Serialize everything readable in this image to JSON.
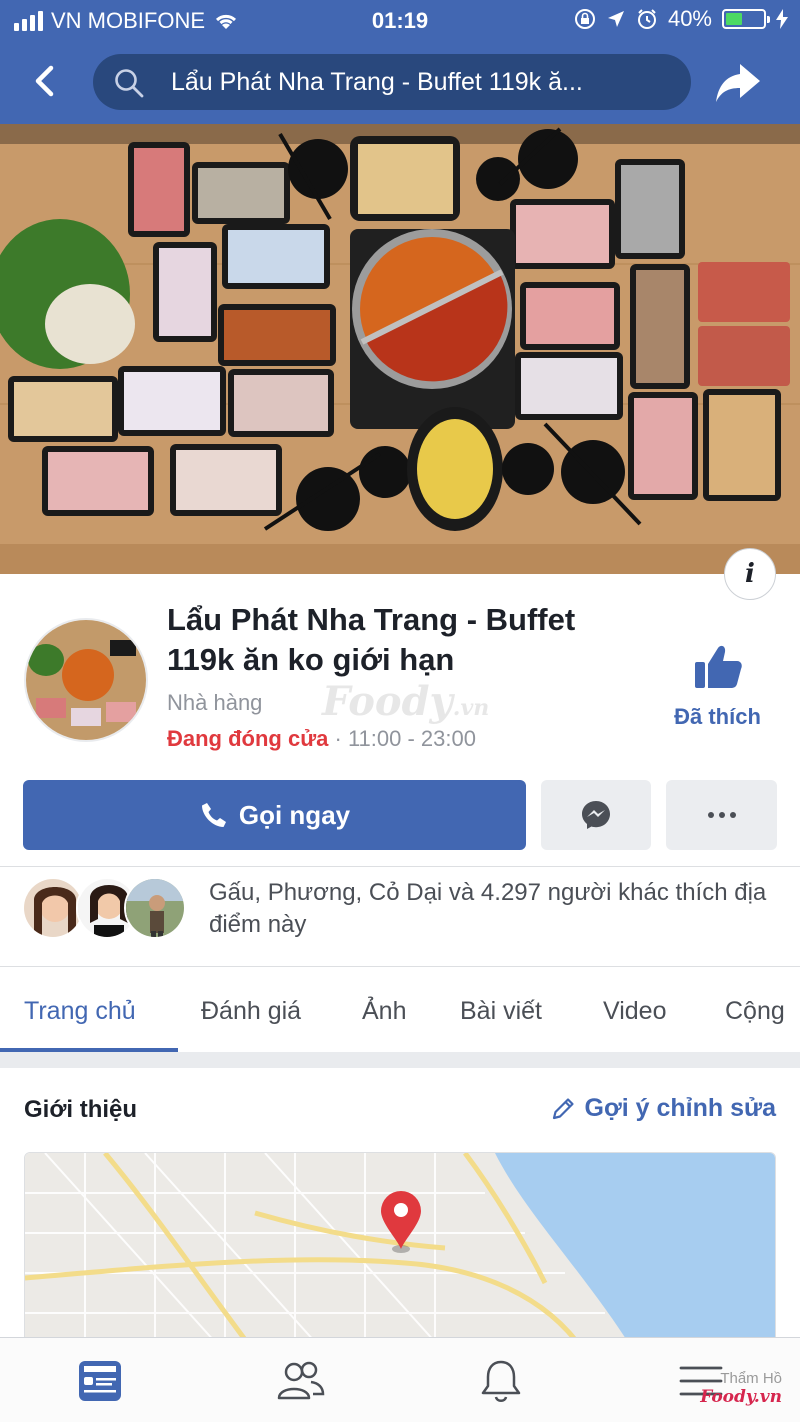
{
  "status_bar": {
    "carrier": "VN MOBIFONE",
    "time": "01:19",
    "battery": "40%",
    "battery_level": 0.4,
    "icons": [
      "signal-icon",
      "wifi-icon",
      "rotation-lock-icon",
      "location-icon",
      "alarm-icon",
      "battery-icon",
      "charging-icon"
    ]
  },
  "nav": {
    "search_text": "Lẩu Phát Nha Trang - Buffet 119k ă...",
    "back_icon": "back-arrow-icon",
    "share_icon": "share-icon"
  },
  "profile": {
    "name": "Lẩu Phát Nha Trang - Buffet 119k ăn ko giới hạn",
    "category": "Nhà hàng",
    "status": "Đang đóng cửa",
    "hours": " · 11:00 - 23:00",
    "like_label": "Đã thích",
    "watermark": "Foody.vn"
  },
  "actions": {
    "call_label": "Gọi ngay",
    "messenger_icon": "messenger-icon",
    "more_icon": "more-icon"
  },
  "friends": {
    "text": "Gấu, Phương, Cỏ Dại và 4.297 người khác thích địa điểm này"
  },
  "tabs": [
    {
      "label": "Trang chủ",
      "active": true
    },
    {
      "label": "Đánh giá"
    },
    {
      "label": "Ảnh"
    },
    {
      "label": "Bài viết"
    },
    {
      "label": "Video"
    },
    {
      "label": "Cộng"
    }
  ],
  "intro": {
    "title": "Giới thiệu",
    "suggest_edit": "Gợi ý chỉnh sửa"
  },
  "bottom_nav": [
    "feed-icon",
    "friends-icon",
    "notifications-icon",
    "menu-icon"
  ],
  "footer_watermark": {
    "line1": "Thẩm Hồ",
    "line2": "Foody.vn"
  },
  "colors": {
    "brand": "#4267b2",
    "closed": "#e0393e"
  }
}
